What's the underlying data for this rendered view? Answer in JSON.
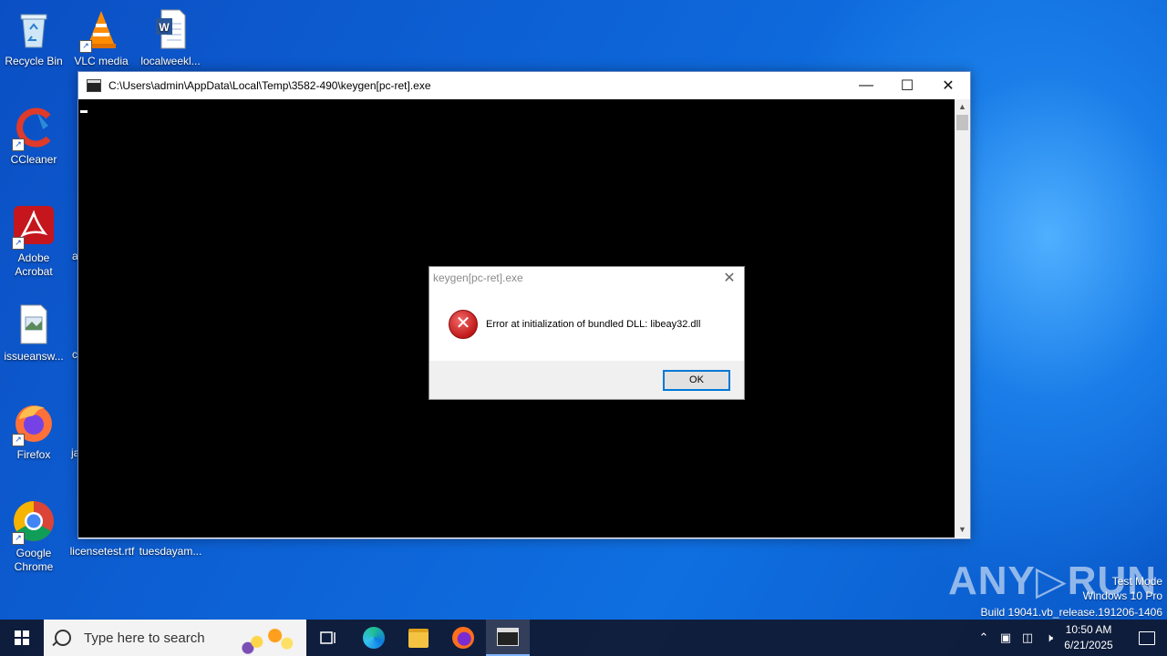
{
  "desktop": {
    "icons": [
      {
        "label": "Recycle Bin"
      },
      {
        "label": "VLC media"
      },
      {
        "label": "localweekl..."
      },
      {
        "label": "CCleaner"
      },
      {
        "label": "Adobe Acrobat"
      },
      {
        "label": "issueansw..."
      },
      {
        "label": "Firefox"
      },
      {
        "label": "Google Chrome"
      },
      {
        "label": "licensetest.rtf"
      },
      {
        "label": "tuesdayam..."
      }
    ],
    "partial_labels": [
      "a",
      "c",
      "ja"
    ]
  },
  "console": {
    "title": "C:\\Users\\admin\\AppData\\Local\\Temp\\3582-490\\keygen[pc-ret].exe",
    "minimize": "—",
    "maximize": "☐",
    "close": "✕"
  },
  "dialog": {
    "title": "keygen[pc-ret].exe",
    "message": "Error at initialization of bundled DLL: libeay32.dll",
    "ok_label": "OK",
    "close": "✕"
  },
  "watermark": {
    "brand": "ANY▷RUN",
    "mode": "Test Mode",
    "edition": "Windows 10 Pro",
    "build": "Build 19041.vb_release.191206-1406"
  },
  "taskbar": {
    "search_placeholder": "Type here to search",
    "time": "10:50 AM",
    "date": "6/21/2025"
  }
}
